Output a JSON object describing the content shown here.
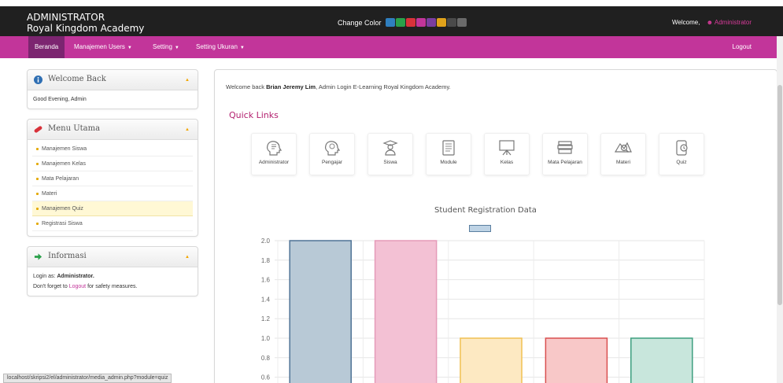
{
  "header": {
    "role": "ADMINISTRATOR",
    "academy": "Royal Kingdom Academy",
    "change_color_label": "Change Color",
    "swatches": [
      "#2f7fbf",
      "#2aa04a",
      "#d8323a",
      "#c2359a",
      "#7a3ea0",
      "#e0a21b",
      "#4a4a4a",
      "#6a6a6a"
    ],
    "welcome_label": "Welcome,",
    "user_name": "Administrator"
  },
  "nav": {
    "items": [
      "Beranda",
      "Manajemen Users",
      "Setting",
      "Setting Ukuran"
    ],
    "logout": "Logout"
  },
  "sidebar": {
    "welcome_title": "Welcome Back",
    "greeting": "Good Evening, Admin",
    "menu_title": "Menu Utama",
    "menu_items": [
      "Manajemen Siswa",
      "Manajemen Kelas",
      "Mata Pelajaran",
      "Materi",
      "Manajemen Quiz",
      "Registrasi Siswa"
    ],
    "info_title": "Informasi",
    "login_as_label": "Login as:",
    "login_as_user": "Administrator.",
    "forget_prefix": "Don't forget to",
    "forget_link": "Logout",
    "forget_suffix": "for safety measures."
  },
  "main": {
    "welcome_prefix": "Welcome back",
    "welcome_name": "Brian Jeremy Lim",
    "welcome_suffix": ", Admin Login E-Learning Royal Kingdom Academy.",
    "quick_links_title": "Quick Links",
    "quick_links": [
      {
        "label": "Administrator",
        "icon": "administrator-icon"
      },
      {
        "label": "Pengajar",
        "icon": "teacher-icon"
      },
      {
        "label": "Siswa",
        "icon": "student-icon"
      },
      {
        "label": "Module",
        "icon": "module-icon"
      },
      {
        "label": "Kelas",
        "icon": "class-board-icon"
      },
      {
        "label": "Mata Pelajaran",
        "icon": "books-icon"
      },
      {
        "label": "Materi",
        "icon": "materi-icon"
      },
      {
        "label": "Quiz",
        "icon": "quiz-icon"
      }
    ]
  },
  "chart_data": {
    "type": "bar",
    "title": "Student Registration Data",
    "values": [
      2,
      2,
      1,
      1,
      1
    ],
    "bar_colors": [
      "#b8c9d6",
      "#f3c1d4",
      "#fde9c2",
      "#f8c8c8",
      "#c8e6dc"
    ],
    "bar_borders": [
      "#4f7396",
      "#e59ab8",
      "#f0c052",
      "#d94f4f",
      "#3d9f7f"
    ],
    "yticks": [
      "0.6",
      "0.8",
      "1.0",
      "1.2",
      "1.4",
      "1.6",
      "1.8",
      "2.0"
    ],
    "grid": true
  },
  "status_bar": {
    "url": "localhost/skripsi2/el/administrator/media_admin.php?module=quiz"
  }
}
